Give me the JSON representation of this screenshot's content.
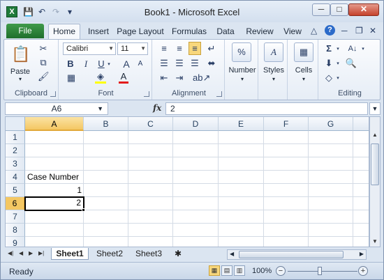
{
  "window": {
    "title": "Book1 - Microsoft Excel",
    "app_icon": "X"
  },
  "qat": {
    "save_icon": "💾",
    "undo_icon": "↶",
    "redo_icon": "↷",
    "customize_icon": "▾"
  },
  "window_controls": {
    "minimize": "─",
    "maximize": "□",
    "close": "✕"
  },
  "tabs": {
    "file": "File",
    "items": [
      "Home",
      "Insert",
      "Page Layout",
      "Formulas",
      "Data",
      "Review",
      "View"
    ],
    "active": "Home"
  },
  "ribbon_controls": {
    "minimize_ribbon": "△",
    "help": "?",
    "doc_minimize": "─",
    "doc_restore": "❐",
    "doc_close": "✕"
  },
  "ribbon": {
    "clipboard": {
      "label": "Clipboard",
      "paste": "Paste"
    },
    "font": {
      "label": "Font",
      "name": "Calibri",
      "size": "11",
      "bold": "B",
      "italic": "I",
      "underline": "U",
      "grow": "A",
      "shrink": "A",
      "color_letter": "A"
    },
    "alignment": {
      "label": "Alignment"
    },
    "number": {
      "label": "Number",
      "icon": "%"
    },
    "styles": {
      "label": "Styles",
      "icon": "A"
    },
    "cells": {
      "label": "Cells",
      "icon": "▦"
    },
    "editing": {
      "label": "Editing",
      "sum": "Σ",
      "sort": "A↓",
      "clear": "◇"
    }
  },
  "formula_bar": {
    "name_box": "A6",
    "fx": "fx",
    "value": "2"
  },
  "sheet": {
    "columns": [
      "A",
      "B",
      "C",
      "D",
      "E",
      "F",
      "G"
    ],
    "selected_column": "A",
    "rows": [
      "1",
      "2",
      "3",
      "4",
      "5",
      "6",
      "7",
      "8",
      "9"
    ],
    "selected_row": "6",
    "cells": {
      "A4": "Case Number",
      "A5": "1",
      "A6": "2"
    }
  },
  "sheet_tabs": {
    "items": [
      "Sheet1",
      "Sheet2",
      "Sheet3"
    ],
    "active": "Sheet1"
  },
  "status": {
    "text": "Ready",
    "zoom": "100%",
    "zoom_out": "−",
    "zoom_in": "+"
  }
}
